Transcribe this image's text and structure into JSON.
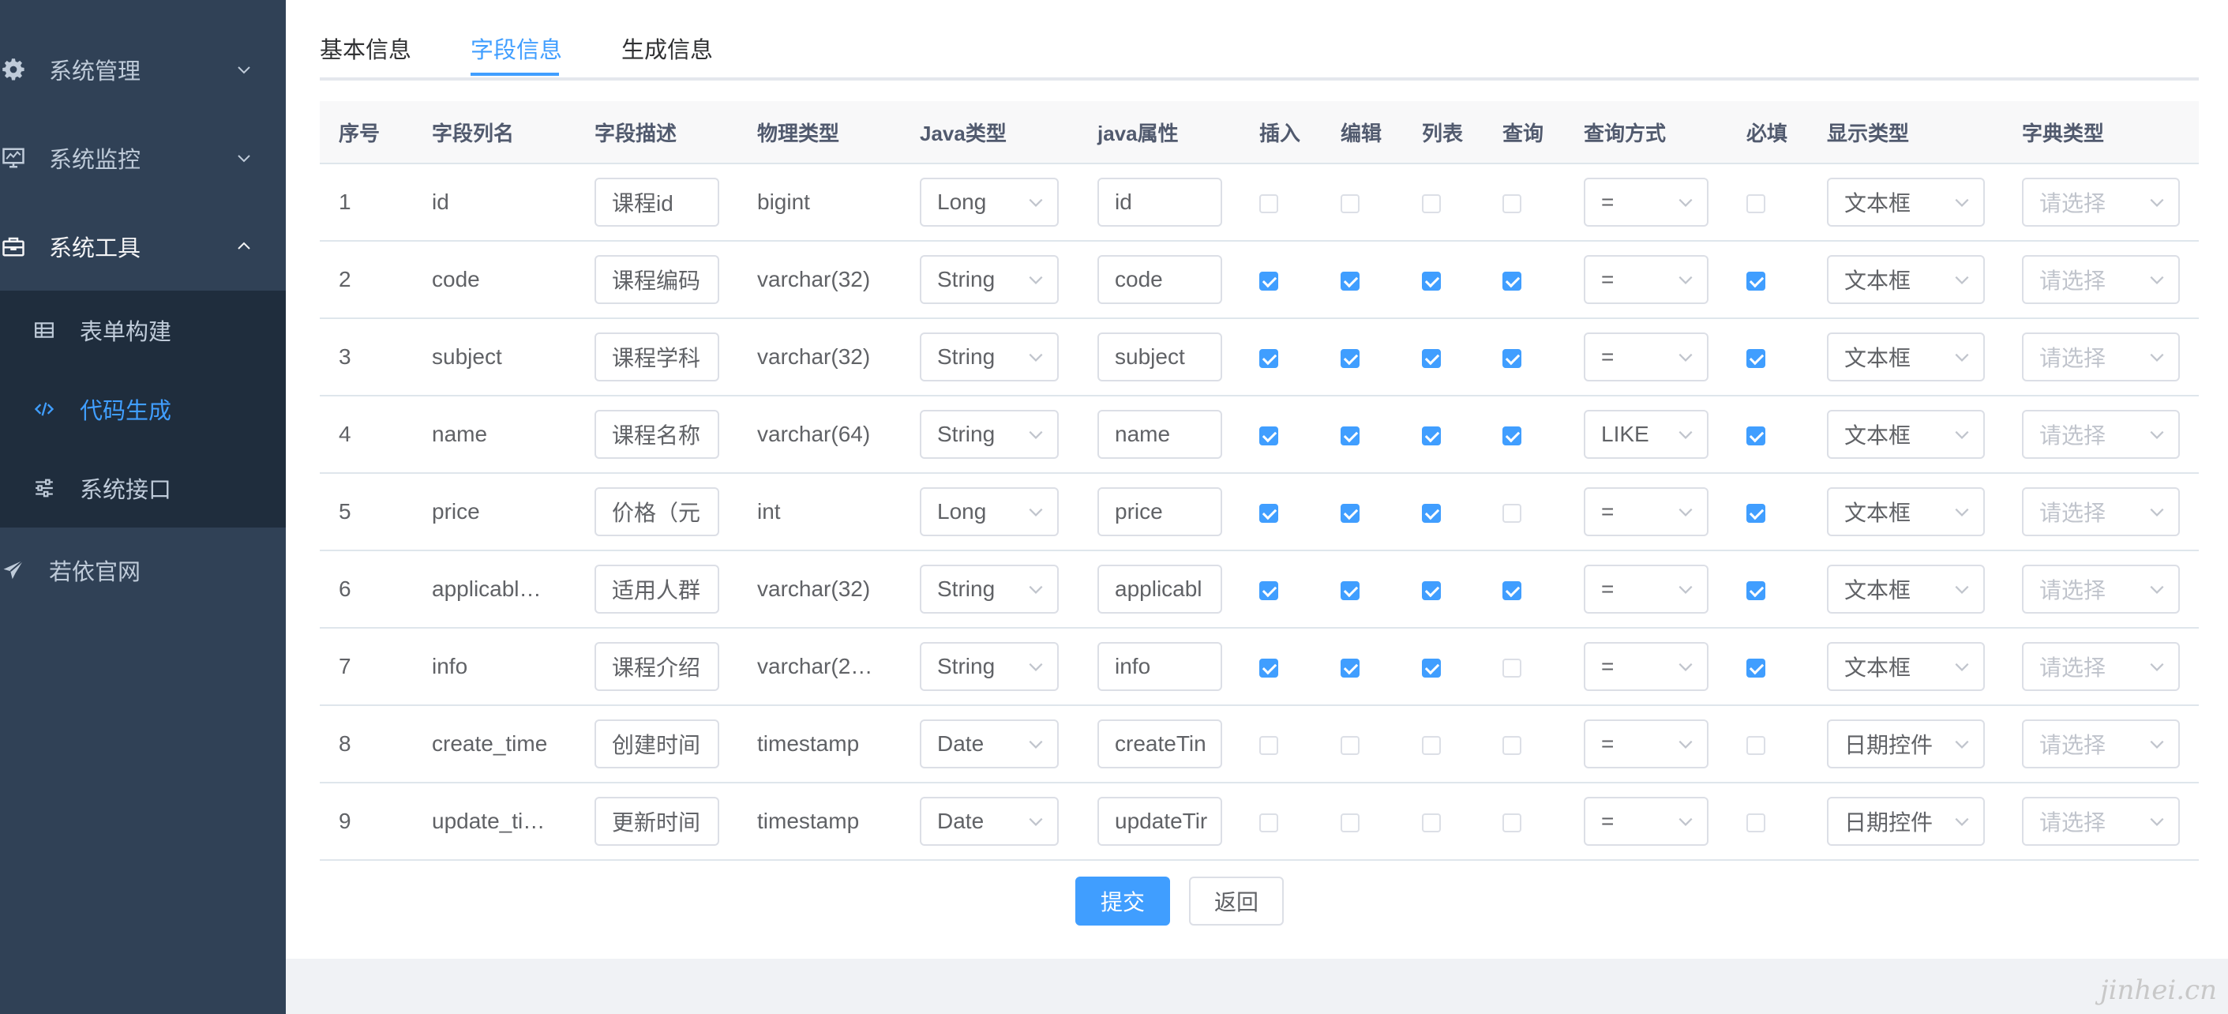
{
  "sidebar": {
    "menu": [
      {
        "label": "系统管理",
        "icon": "gear-icon"
      },
      {
        "label": "系统监控",
        "icon": "monitor-icon"
      },
      {
        "label": "系统工具",
        "icon": "toolbox-icon"
      },
      {
        "label": "若依官网",
        "icon": "send-icon"
      }
    ],
    "sub": [
      {
        "label": "表单构建",
        "icon": "table-icon"
      },
      {
        "label": "代码生成",
        "icon": "code-icon"
      },
      {
        "label": "系统接口",
        "icon": "sliders-icon"
      }
    ]
  },
  "tabs": [
    "基本信息",
    "字段信息",
    "生成信息"
  ],
  "colors": {
    "accent": "#409eff",
    "sidebar": "#304156",
    "submenu": "#1f2d3d"
  },
  "table": {
    "headers": [
      "序号",
      "字段列名",
      "字段描述",
      "物理类型",
      "Java类型",
      "java属性",
      "插入",
      "编辑",
      "列表",
      "查询",
      "查询方式",
      "必填",
      "显示类型",
      "字典类型"
    ],
    "rows": [
      {
        "no": "1",
        "col": "id",
        "desc": "课程id",
        "phys": "bigint",
        "jtype": "Long",
        "jprop": "id",
        "ins": false,
        "edit": false,
        "list": false,
        "query": false,
        "qtype": "=",
        "req": false,
        "show": "文本框",
        "dict": "请选择"
      },
      {
        "no": "2",
        "col": "code",
        "desc": "课程编码",
        "phys": "varchar(32)",
        "jtype": "String",
        "jprop": "code",
        "ins": true,
        "edit": true,
        "list": true,
        "query": true,
        "qtype": "=",
        "req": true,
        "show": "文本框",
        "dict": "请选择"
      },
      {
        "no": "3",
        "col": "subject",
        "desc": "课程学科",
        "phys": "varchar(32)",
        "jtype": "String",
        "jprop": "subject",
        "ins": true,
        "edit": true,
        "list": true,
        "query": true,
        "qtype": "=",
        "req": true,
        "show": "文本框",
        "dict": "请选择"
      },
      {
        "no": "4",
        "col": "name",
        "desc": "课程名称",
        "phys": "varchar(64)",
        "jtype": "String",
        "jprop": "name",
        "ins": true,
        "edit": true,
        "list": true,
        "query": true,
        "qtype": "LIKE",
        "req": true,
        "show": "文本框",
        "dict": "请选择"
      },
      {
        "no": "5",
        "col": "price",
        "desc": "价格（元",
        "phys": "int",
        "jtype": "Long",
        "jprop": "price",
        "ins": true,
        "edit": true,
        "list": true,
        "query": false,
        "qtype": "=",
        "req": true,
        "show": "文本框",
        "dict": "请选择"
      },
      {
        "no": "6",
        "col": "applicabl…",
        "desc": "适用人群",
        "phys": "varchar(32)",
        "jtype": "String",
        "jprop": "applicabl",
        "ins": true,
        "edit": true,
        "list": true,
        "query": true,
        "qtype": "=",
        "req": true,
        "show": "文本框",
        "dict": "请选择"
      },
      {
        "no": "7",
        "col": "info",
        "desc": "课程介绍",
        "phys": "varchar(2…",
        "jtype": "String",
        "jprop": "info",
        "ins": true,
        "edit": true,
        "list": true,
        "query": false,
        "qtype": "=",
        "req": true,
        "show": "文本框",
        "dict": "请选择"
      },
      {
        "no": "8",
        "col": "create_time",
        "desc": "创建时间",
        "phys": "timestamp",
        "jtype": "Date",
        "jprop": "createTin",
        "ins": false,
        "edit": false,
        "list": false,
        "query": false,
        "qtype": "=",
        "req": false,
        "show": "日期控件",
        "dict": "请选择"
      },
      {
        "no": "9",
        "col": "update_ti…",
        "desc": "更新时间",
        "phys": "timestamp",
        "jtype": "Date",
        "jprop": "updateTir",
        "ins": false,
        "edit": false,
        "list": false,
        "query": false,
        "qtype": "=",
        "req": false,
        "show": "日期控件",
        "dict": "请选择"
      }
    ]
  },
  "buttons": {
    "submit": "提交",
    "back": "返回"
  },
  "watermark": "jinhei.cn"
}
